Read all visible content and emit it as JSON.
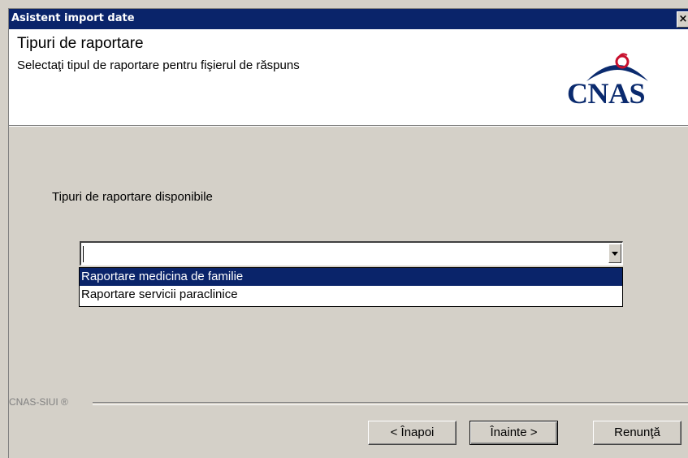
{
  "window": {
    "title": "Asistent import date",
    "close_glyph": "×"
  },
  "header": {
    "title": "Tipuri de raportare",
    "subtitle": "Selectaţi tipul de raportare pentru fişierul de răspuns",
    "logo_text": "CNAS",
    "logo_colors": {
      "text": "#0a2a6e",
      "accent": "#c8102e"
    }
  },
  "main": {
    "section_label": "Tipuri de raportare disponibile",
    "combo": {
      "value": "",
      "options": [
        {
          "label": "Raportare medicina de familie",
          "selected": true
        },
        {
          "label": "Raportare servicii paraclinice",
          "selected": false
        }
      ]
    }
  },
  "footer": {
    "brand": "CNAS-SIUI ®",
    "buttons": {
      "back": "< Înapoi",
      "next": "Înainte >",
      "cancel": "Renunţă"
    }
  },
  "colors": {
    "titlebar": "#0a246a",
    "selection": "#0a246a",
    "face": "#d4d0c8"
  }
}
